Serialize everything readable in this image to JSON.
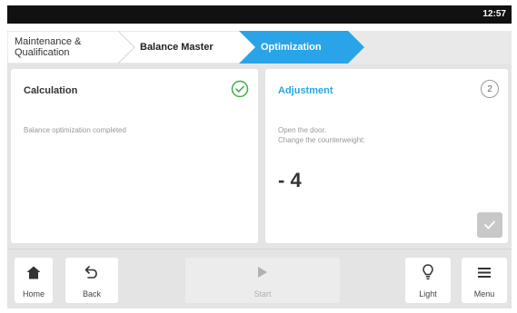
{
  "status_bar": {
    "time": "12:57"
  },
  "breadcrumb": {
    "items": [
      {
        "label": "Maintenance &\nQualification"
      },
      {
        "label": "Balance Master"
      },
      {
        "label": "Optimization"
      }
    ],
    "active_color": "#2aa4e8"
  },
  "calculation": {
    "title": "Calculation",
    "message": "Balance optimization completed",
    "status_icon": "check-circle-icon"
  },
  "adjustment": {
    "title": "Adjustment",
    "step": "2",
    "instruction_line1": "Open the door.",
    "instruction_line2": "Change the counterweight:",
    "value": "- 4",
    "confirm_icon": "checkmark-icon"
  },
  "taskbar": {
    "home_label": "Home",
    "back_label": "Back",
    "start_label": "Start",
    "light_label": "Light",
    "menu_label": "Menu"
  }
}
